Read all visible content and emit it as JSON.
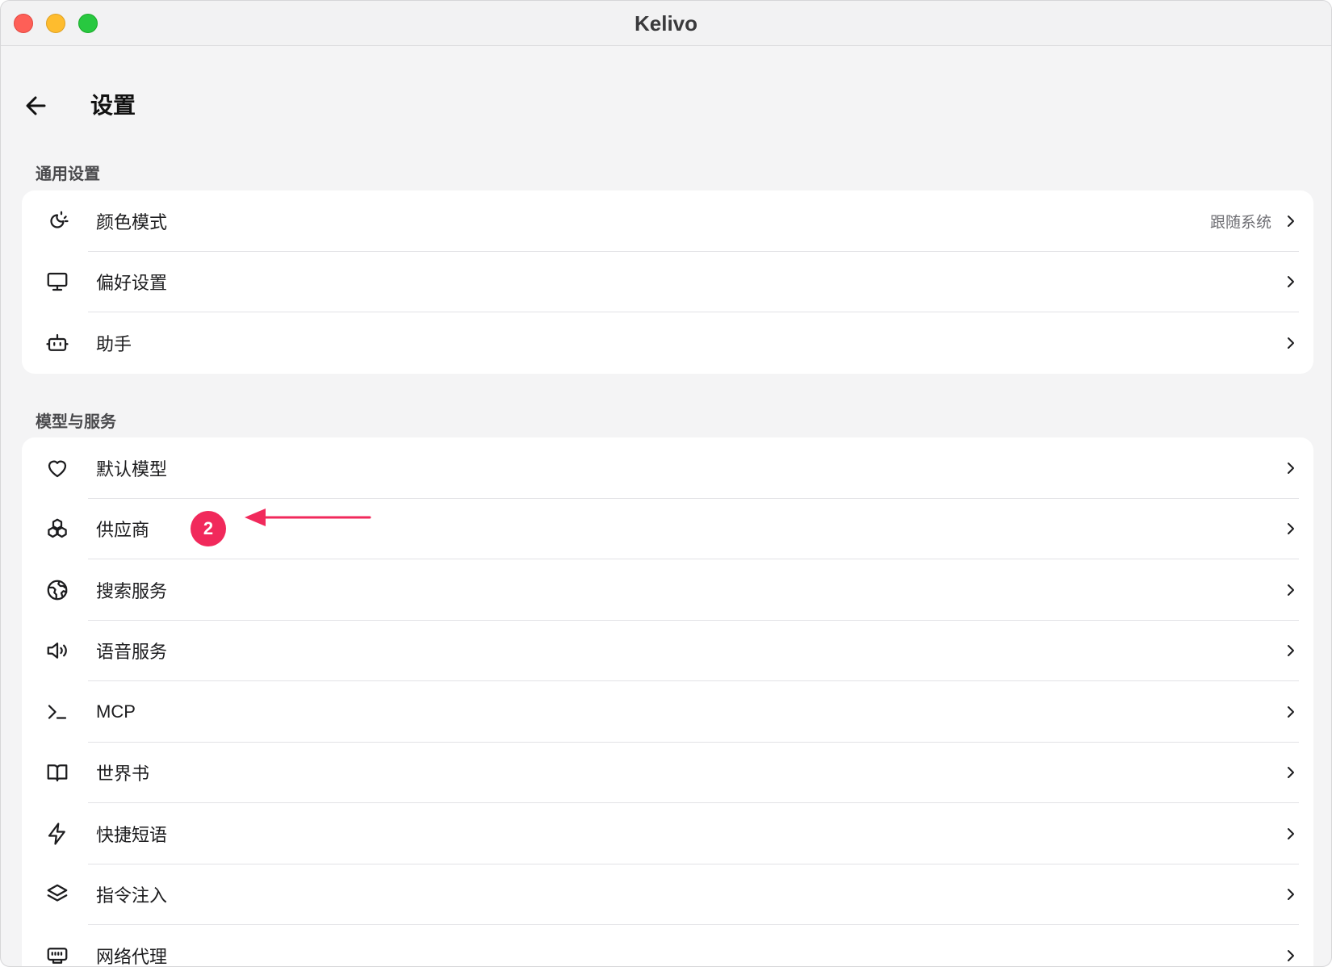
{
  "window": {
    "title": "Kelivo"
  },
  "header": {
    "title": "设置"
  },
  "sections": [
    {
      "label": "通用设置",
      "items": [
        {
          "label": "颜色模式",
          "value": "跟随系统",
          "icon": "theme-icon"
        },
        {
          "label": "偏好设置",
          "value": "",
          "icon": "monitor-icon"
        },
        {
          "label": "助手",
          "value": "",
          "icon": "bot-icon"
        }
      ]
    },
    {
      "label": "模型与服务",
      "items": [
        {
          "label": "默认模型",
          "icon": "heart-icon"
        },
        {
          "label": "供应商",
          "icon": "boxes-icon",
          "badge": "2"
        },
        {
          "label": "搜索服务",
          "icon": "globe-icon"
        },
        {
          "label": "语音服务",
          "icon": "speaker-icon"
        },
        {
          "label": "MCP",
          "icon": "terminal-icon"
        },
        {
          "label": "世界书",
          "icon": "book-icon"
        },
        {
          "label": "快捷短语",
          "icon": "zap-icon"
        },
        {
          "label": "指令注入",
          "icon": "layers-icon"
        },
        {
          "label": "网络代理",
          "icon": "network-icon"
        }
      ]
    }
  ],
  "colors": {
    "badge": "#f1295b",
    "annotation_arrow": "#f1295b"
  }
}
